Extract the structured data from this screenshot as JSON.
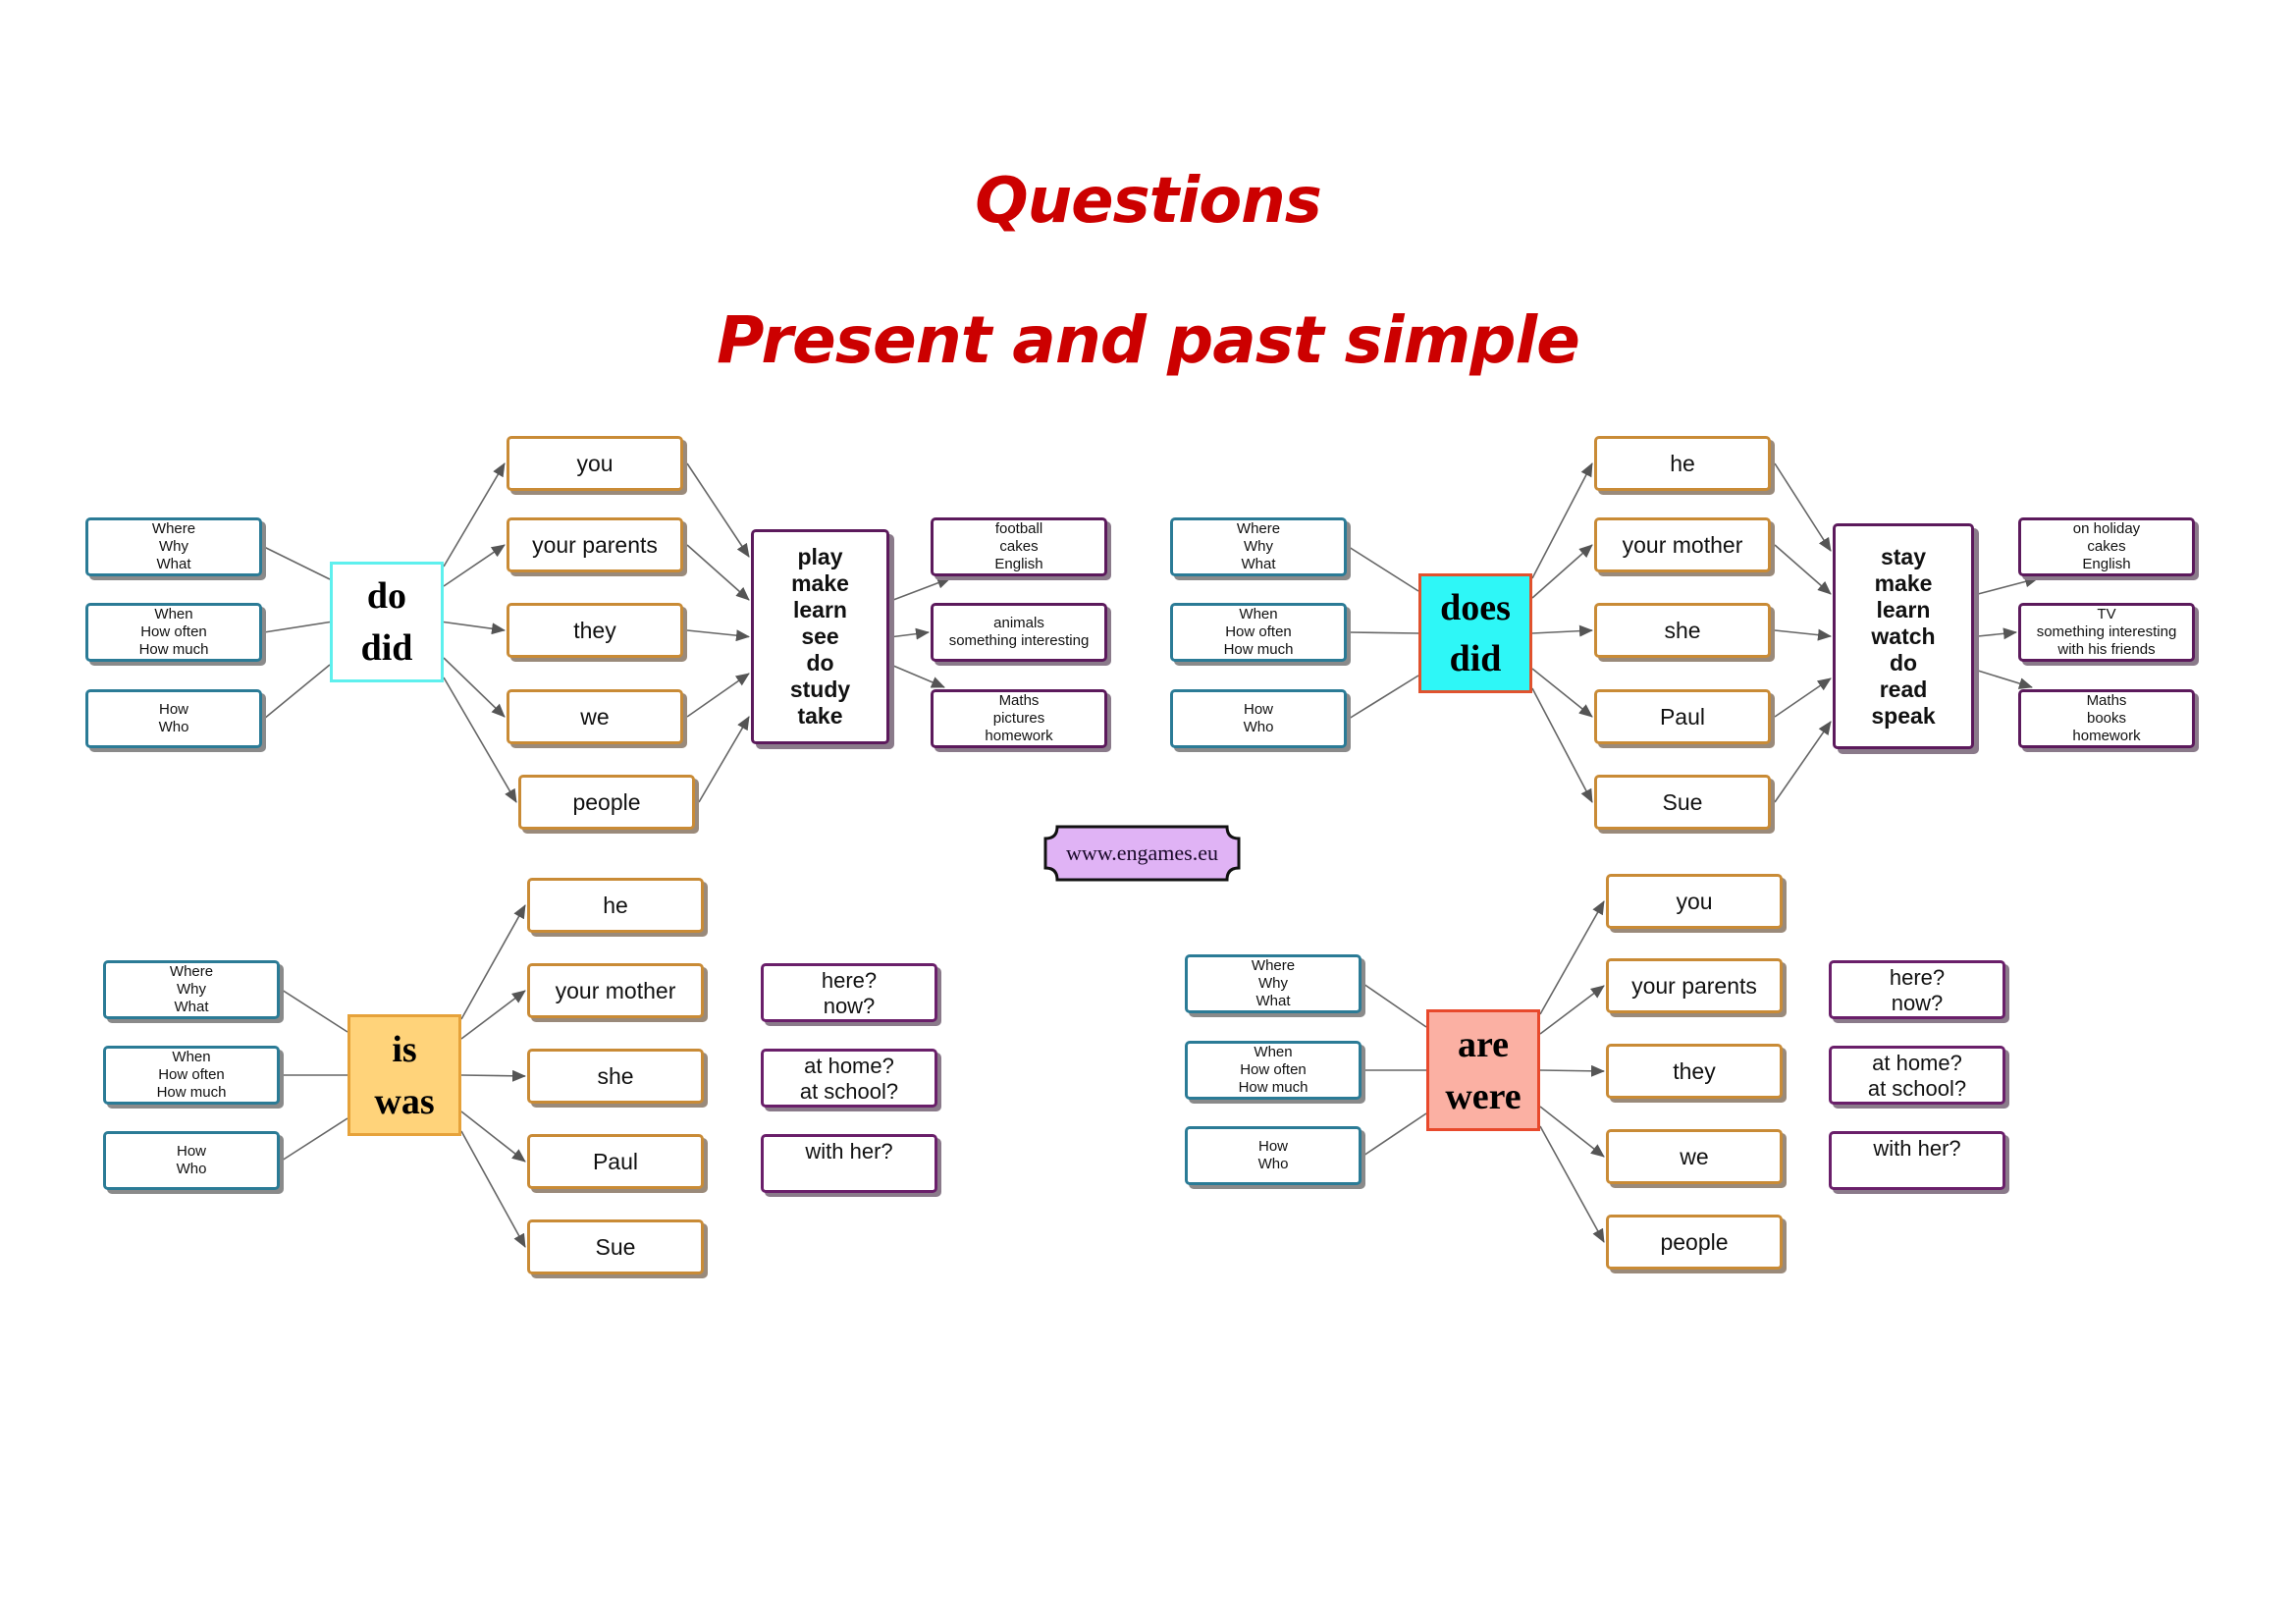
{
  "title": "Questions",
  "subtitle": "Present and past simple",
  "website": "www.engames.eu",
  "colors": {
    "title": "#cc0000",
    "question_border": "#2b7b96",
    "subject_border": "#c98b36",
    "verb_border": "#5c1a5c",
    "do_did_border": "#5ef0ee",
    "does_did_fill": "#2ef7f7",
    "does_did_border": "#e0522e",
    "is_was_fill": "#ffd37a",
    "is_was_border": "#e6a23a",
    "are_were_fill": "#fbb0a3",
    "are_were_border": "#e8492c",
    "logo_fill": "#e0b3f5"
  },
  "sections": {
    "present_do": {
      "question_words": [
        [
          "Where",
          "Why",
          "What"
        ],
        [
          "When",
          "How often",
          "How much"
        ],
        [
          "How",
          "Who"
        ]
      ],
      "auxiliary": [
        "do",
        "did"
      ],
      "subjects": [
        "you",
        "your parents",
        "they",
        "we",
        "people"
      ],
      "verbs": [
        "play",
        "make",
        "learn",
        "see",
        "do",
        "study",
        "take"
      ],
      "objects": [
        [
          "football",
          "cakes",
          "English"
        ],
        [
          "animals",
          "something interesting"
        ],
        [
          "Maths",
          "pictures",
          "homework"
        ]
      ]
    },
    "present_does": {
      "question_words": [
        [
          "Where",
          "Why",
          "What"
        ],
        [
          "When",
          "How often",
          "How much"
        ],
        [
          "How",
          "Who"
        ]
      ],
      "auxiliary": [
        "does",
        "did"
      ],
      "subjects": [
        "he",
        "your mother",
        "she",
        "Paul",
        "Sue"
      ],
      "verbs": [
        "stay",
        "make",
        "learn",
        "watch",
        "do",
        "read",
        "speak"
      ],
      "objects": [
        [
          "on holiday",
          "cakes",
          "English"
        ],
        [
          "TV",
          "something interesting",
          "with his friends"
        ],
        [
          "Maths",
          "books",
          "homework"
        ]
      ]
    },
    "be_is": {
      "question_words": [
        [
          "Where",
          "Why",
          "What"
        ],
        [
          "When",
          "How often",
          "How much"
        ],
        [
          "How",
          "Who"
        ]
      ],
      "auxiliary": [
        "is",
        "was"
      ],
      "subjects": [
        "he",
        "your mother",
        "she",
        "Paul",
        "Sue"
      ],
      "complements": [
        [
          "here?",
          "now?"
        ],
        [
          "at home?",
          "at school?"
        ],
        [
          "with her?"
        ]
      ]
    },
    "be_are": {
      "question_words": [
        [
          "Where",
          "Why",
          "What"
        ],
        [
          "When",
          "How often",
          "How much"
        ],
        [
          "How",
          "Who"
        ]
      ],
      "auxiliary": [
        "are",
        "were"
      ],
      "subjects": [
        "you",
        "your parents",
        "they",
        "we",
        "people"
      ],
      "complements": [
        [
          "here?",
          "now?"
        ],
        [
          "at home?",
          "at school?"
        ],
        [
          "with her?"
        ]
      ]
    }
  }
}
